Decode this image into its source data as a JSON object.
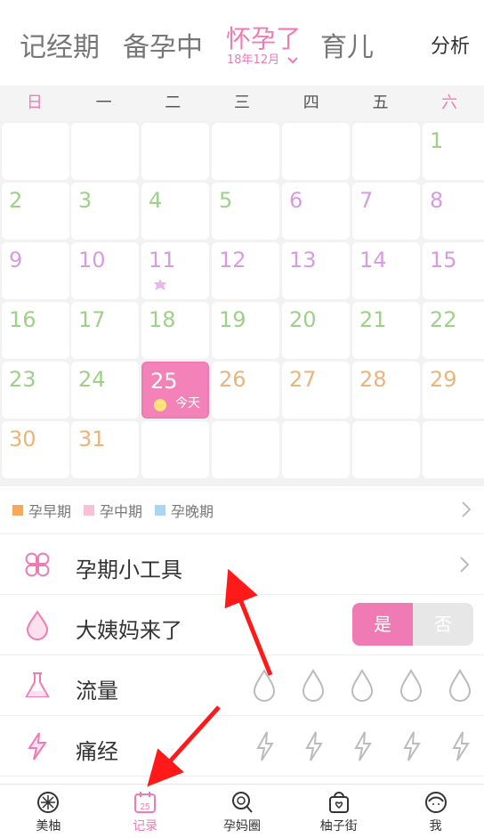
{
  "header": {
    "tabs": [
      {
        "label": "记经期"
      },
      {
        "label": "备孕中"
      },
      {
        "label": "怀孕了",
        "sub": "18年12月"
      },
      {
        "label": "育儿"
      }
    ],
    "right_action": "分析"
  },
  "calendar": {
    "weekdays": [
      "日",
      "一",
      "二",
      "三",
      "四",
      "五",
      "六"
    ],
    "today_label": "今天",
    "cells": [
      {
        "day": "1"
      },
      {
        "day": "2"
      },
      {
        "day": "3"
      },
      {
        "day": "4"
      },
      {
        "day": "5"
      },
      {
        "day": "6"
      },
      {
        "day": "7"
      },
      {
        "day": "8"
      },
      {
        "day": "9"
      },
      {
        "day": "10"
      },
      {
        "day": "11"
      },
      {
        "day": "12"
      },
      {
        "day": "13"
      },
      {
        "day": "14"
      },
      {
        "day": "15"
      },
      {
        "day": "16"
      },
      {
        "day": "17"
      },
      {
        "day": "18"
      },
      {
        "day": "19"
      },
      {
        "day": "20"
      },
      {
        "day": "21"
      },
      {
        "day": "22"
      },
      {
        "day": "23"
      },
      {
        "day": "24"
      },
      {
        "day": "25"
      },
      {
        "day": "26"
      },
      {
        "day": "27"
      },
      {
        "day": "28"
      },
      {
        "day": "29"
      },
      {
        "day": "30"
      },
      {
        "day": "31"
      }
    ]
  },
  "legend": [
    {
      "label": "孕早期",
      "color": "#f6a95b"
    },
    {
      "label": "孕中期",
      "color": "#f8bfd7"
    },
    {
      "label": "孕晚期",
      "color": "#a9d6f0"
    }
  ],
  "rows": {
    "tools": {
      "label": "孕期小工具"
    },
    "period": {
      "label": "大姨妈来了",
      "yes": "是",
      "no": "否"
    },
    "flow": {
      "label": "流量"
    },
    "cramps": {
      "label": "痛经"
    }
  },
  "bottom_nav": [
    {
      "label": "美柚",
      "icon": "meiyou-icon"
    },
    {
      "label": "记录",
      "icon": "calendar-25-icon",
      "icon_text": "25"
    },
    {
      "label": "孕妈圈",
      "icon": "lollipop-icon"
    },
    {
      "label": "柚子街",
      "icon": "bag-icon"
    },
    {
      "label": "我",
      "icon": "user-icon"
    }
  ],
  "colors": {
    "accent": "#f07ab3",
    "green_day": "#9ed08a",
    "purple_day": "#d79be0",
    "orange_day": "#eab47b"
  }
}
